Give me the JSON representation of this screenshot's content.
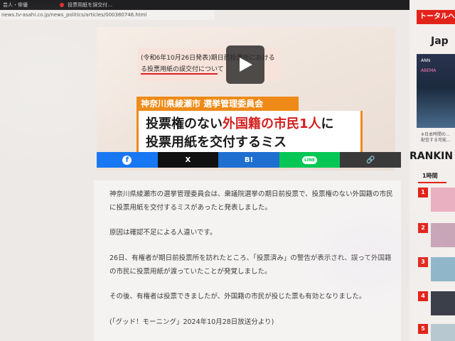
{
  "browser": {
    "tabs": [
      {
        "label": "芸人・俳優"
      },
      {
        "label": "投票用紙を誤交付…"
      }
    ],
    "url": "news.tv-asahi.co.jp/news_politics/articles/000380746.html"
  },
  "video": {
    "notice_line1": "(令和6年10月26日発表)期日前投票所における",
    "notice_line2": "る投票用紙の誤交付について",
    "city_banner": "神奈川県綾瀬市 選挙管理委員会",
    "headline_part1": "投票権のない",
    "headline_highlight": "外国籍の市民1人",
    "headline_part3": "に",
    "headline_line2": "投票用紙を交付するミス"
  },
  "share": {
    "facebook": "f",
    "x": "X",
    "hatena": "B!",
    "line": "LINE",
    "link": "🔗"
  },
  "article": {
    "paragraphs": [
      "神奈川県綾瀬市の選挙管理委員会は、衆議院選挙の期日前投票で、投票権のない外国籍の市民に投票用紙を交付するミスがあったと発表しました。",
      "原因は確認不足による人違いです。",
      "26日、有権者が期日前投票所を訪れたところ、「投票済み」の警告が表示され、誤って外国籍の市民に投票用紙が渡っていたことが発覚しました。",
      "その後、有権者は投票できましたが、外国籍の市民が投じた票も有効となりました。",
      "(「グッド！モーニング」2024年10月28日放送分より)"
    ]
  },
  "sidebar": {
    "total_header": "トータルヘル",
    "jap_label": "Jap",
    "promo_tag": "ANN",
    "promo_tag2": "ABEMA",
    "promo_caption_1": "※日本時間の…",
    "promo_caption_2": "配信する可能…",
    "ranking_title": "RANKIN",
    "ranking_tab": "1時間",
    "ranks": [
      "1",
      "2",
      "3",
      "4",
      "5"
    ]
  },
  "colors": {
    "accent_red": "#e2231a",
    "banner_orange": "#ee8a17",
    "facebook": "#1877f2",
    "line": "#06c755"
  }
}
